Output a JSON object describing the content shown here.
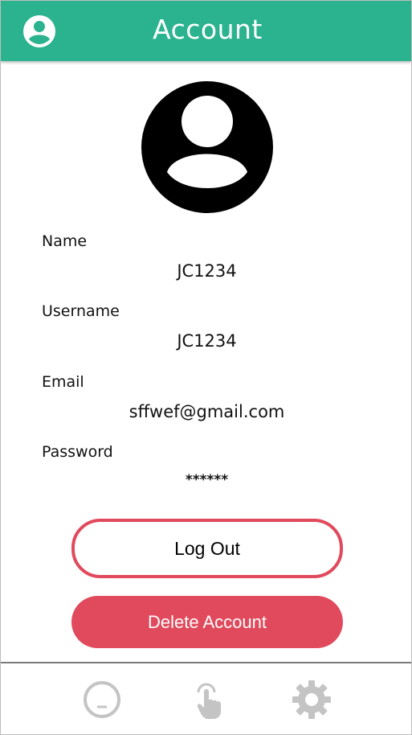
{
  "app_bar": {
    "title": "Account",
    "icon": "account-circle-icon",
    "color": "#2bb38f"
  },
  "profile": {
    "avatar_icon": "account-circle-icon",
    "fields": [
      {
        "label": "Name",
        "value": "JC1234"
      },
      {
        "label": "Username",
        "value": "JC1234"
      },
      {
        "label": "Email",
        "value": "sffwef@gmail.com"
      },
      {
        "label": "Password",
        "value": "******"
      }
    ]
  },
  "buttons": {
    "logout_label": "Log Out",
    "delete_label": "Delete Account",
    "accent_color": "#e04a5c"
  },
  "bottom_nav": {
    "items": [
      {
        "icon": "minimize-circle-icon"
      },
      {
        "icon": "touch-hand-icon"
      },
      {
        "icon": "gear-icon"
      }
    ],
    "icon_color": "#bdbdbd"
  }
}
